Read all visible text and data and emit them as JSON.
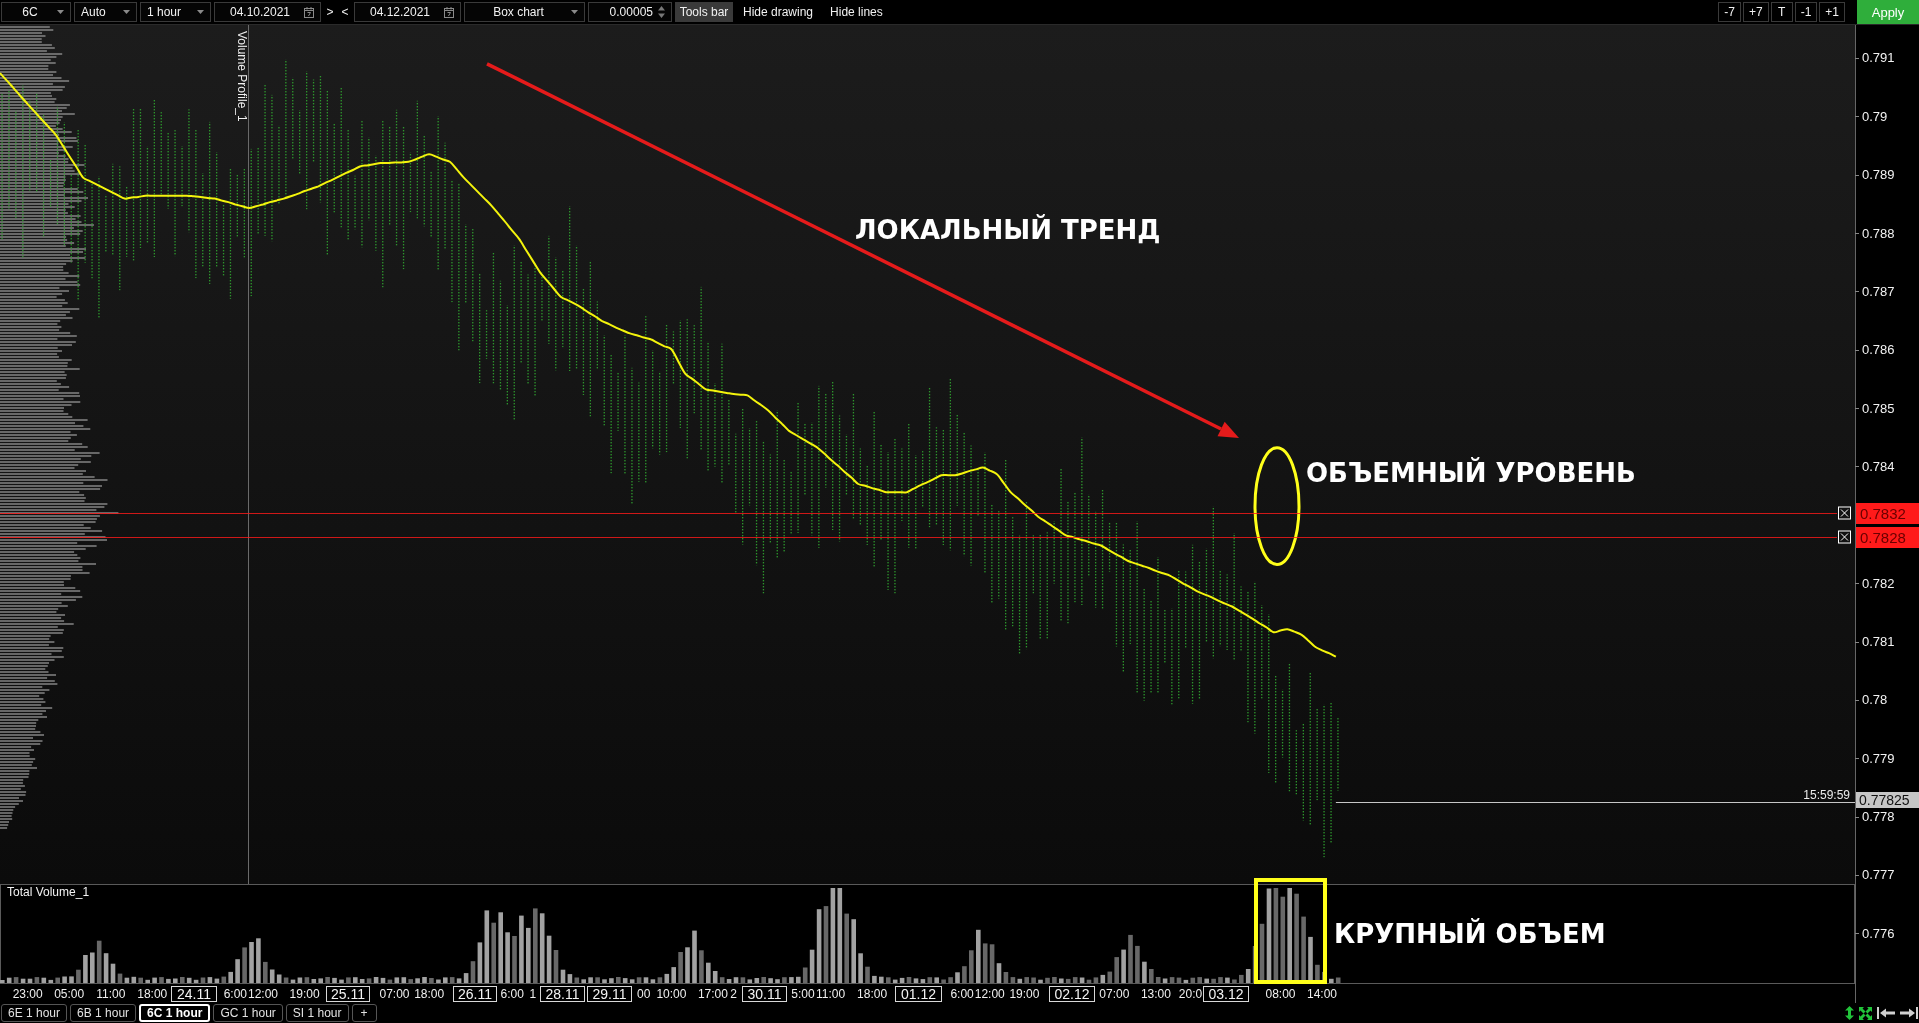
{
  "toolbar": {
    "left": [
      {
        "kind": "dropdown",
        "value": "6C"
      },
      {
        "kind": "dropdown",
        "value": "Auto"
      },
      {
        "kind": "dropdown",
        "value": "1 hour"
      },
      {
        "kind": "date",
        "value": "04.10.2021"
      },
      {
        "kind": "plain",
        "label": ">"
      },
      {
        "kind": "plain",
        "label": "<"
      },
      {
        "kind": "date",
        "value": "04.12.2021"
      },
      {
        "kind": "dropdown",
        "value": "Box chart"
      },
      {
        "kind": "spinner",
        "value": "0.00005"
      },
      {
        "kind": "toggle",
        "label": "Tools bar",
        "on": true
      },
      {
        "kind": "toggle",
        "label": "Hide drawing",
        "on": false
      },
      {
        "kind": "toggle",
        "label": "Hide lines",
        "on": false
      }
    ],
    "right": [
      {
        "kind": "step",
        "label": "-7"
      },
      {
        "kind": "step",
        "label": "+7"
      },
      {
        "kind": "step",
        "label": "T"
      },
      {
        "kind": "step",
        "label": "-1"
      },
      {
        "kind": "step",
        "label": "+1"
      },
      {
        "kind": "apply",
        "label": "Apply"
      }
    ]
  },
  "price_chart": {
    "indicator_label": "Volume Profile_1",
    "last_price_time": "15:59:59",
    "date_marks": [
      "24.11",
      "25.11",
      "26.11",
      "28.11",
      "29.11",
      "30.11",
      "01.12",
      "02.12",
      "03.12"
    ],
    "chart_data": {
      "type": "line",
      "categories": [
        null,
        null,
        null,
        null,
        "23:00",
        null,
        null,
        null,
        null,
        null,
        "05:00",
        null,
        null,
        null,
        null,
        null,
        "11:00",
        null,
        null,
        null,
        null,
        null,
        "18:00",
        null,
        null,
        null,
        null,
        null,
        null,
        null,
        null,
        null,
        null,
        null,
        "6:00",
        null,
        null,
        null,
        "12:00",
        null,
        null,
        null,
        null,
        null,
        "19:00",
        null,
        null,
        null,
        null,
        null,
        null,
        null,
        null,
        null,
        null,
        null,
        null,
        "07:00",
        null,
        null,
        null,
        null,
        "18:00",
        null,
        null,
        null,
        null,
        null,
        null,
        null,
        null,
        null,
        null,
        null,
        "6:00",
        null,
        null,
        "1",
        null,
        null,
        null,
        null,
        null,
        null,
        null,
        null,
        null,
        null,
        null,
        null,
        null,
        null,
        null,
        "00",
        null,
        null,
        null,
        "10:00",
        null,
        null,
        null,
        null,
        null,
        "17:00",
        null,
        null,
        "2",
        null,
        null,
        null,
        null,
        null,
        null,
        null,
        null,
        null,
        "5:00",
        null,
        null,
        null,
        "11:00",
        null,
        null,
        null,
        null,
        null,
        "18:00",
        null,
        null,
        null,
        null,
        null,
        null,
        null,
        null,
        null,
        null,
        null,
        null,
        "6:00",
        null,
        null,
        null,
        "12:00",
        null,
        null,
        null,
        null,
        "19:00",
        null,
        null,
        null,
        null,
        null,
        null,
        null,
        null,
        null,
        null,
        null,
        null,
        "07:00",
        null,
        null,
        null,
        null,
        null,
        "13:00",
        null,
        null,
        null,
        null,
        "20:0",
        null,
        null,
        null,
        null,
        null,
        null,
        null,
        null,
        null,
        null,
        null,
        null,
        "08:00",
        null,
        null,
        null,
        null,
        null,
        "14:00",
        null,
        null,
        null,
        null,
        null,
        null,
        null,
        null,
        null,
        null,
        null,
        null,
        null,
        null,
        null,
        null,
        null,
        null,
        null,
        null,
        null,
        null,
        null,
        null,
        null,
        null,
        null,
        null,
        null,
        null,
        null,
        null,
        null,
        null,
        null,
        null,
        null,
        null,
        null,
        null,
        null,
        null,
        null,
        null,
        null,
        null,
        null,
        null,
        null,
        null,
        null,
        null,
        null,
        null,
        null,
        null,
        null,
        null,
        null,
        null,
        null,
        null,
        null,
        null,
        null,
        null,
        null,
        null,
        null,
        null,
        null,
        null,
        null,
        null,
        null,
        null,
        null
      ],
      "values": [
        0.79074,
        0.79061,
        0.79048,
        0.79034,
        0.79021,
        0.79008,
        0.78995,
        0.78982,
        0.78969,
        0.78951,
        0.78932,
        0.78914,
        0.78895,
        0.78889,
        0.78883,
        0.78877,
        0.78871,
        0.78865,
        0.78859,
        0.78861,
        0.78862,
        0.78864,
        0.78864,
        0.78864,
        0.78864,
        0.78864,
        0.78864,
        0.78864,
        0.78863,
        0.78862,
        0.7886,
        0.78859,
        0.78856,
        0.78853,
        0.78849,
        0.78846,
        0.78843,
        0.78846,
        0.78849,
        0.78853,
        0.78856,
        0.78859,
        0.78863,
        0.78867,
        0.78872,
        0.78876,
        0.7888,
        0.78886,
        0.78891,
        0.78897,
        0.78903,
        0.78908,
        0.78914,
        0.78916,
        0.78918,
        0.7892,
        0.7892,
        0.78921,
        0.78921,
        0.78922,
        0.78926,
        0.78931,
        0.78935,
        0.78931,
        0.78926,
        0.78922,
        0.78909,
        0.78895,
        0.78883,
        0.78871,
        0.78859,
        0.78847,
        0.78833,
        0.78819,
        0.78804,
        0.7879,
        0.78771,
        0.78752,
        0.78733,
        0.78719,
        0.78705,
        0.78691,
        0.78685,
        0.78679,
        0.78672,
        0.78664,
        0.78657,
        0.78649,
        0.78644,
        0.78638,
        0.78633,
        0.78628,
        0.78625,
        0.78621,
        0.78618,
        0.78612,
        0.78606,
        0.78601,
        0.7858,
        0.78559,
        0.7855,
        0.78541,
        0.78532,
        0.7853,
        0.78528,
        0.78526,
        0.78524,
        0.78523,
        0.78522,
        0.78513,
        0.78505,
        0.78496,
        0.78484,
        0.78473,
        0.78461,
        0.78454,
        0.78447,
        0.7844,
        0.78433,
        0.78423,
        0.78412,
        0.78402,
        0.78391,
        0.78381,
        0.7837,
        0.78367,
        0.78363,
        0.7836,
        0.78356,
        0.78356,
        0.78356,
        0.78356,
        0.78362,
        0.78368,
        0.78373,
        0.78379,
        0.78385,
        0.78385,
        0.78385,
        0.78388,
        0.78392,
        0.78395,
        0.78398,
        0.78393,
        0.78387,
        0.78372,
        0.78356,
        0.78346,
        0.78335,
        0.78325,
        0.78314,
        0.78306,
        0.78298,
        0.7829,
        0.78282,
        0.78279,
        0.78275,
        0.78272,
        0.78268,
        0.78265,
        0.78258,
        0.78251,
        0.78245,
        0.78238,
        0.78234,
        0.7823,
        0.78226,
        0.78221,
        0.78217,
        0.78213,
        0.78206,
        0.78199,
        0.78193,
        0.78186,
        0.78181,
        0.78176,
        0.7817,
        0.78165,
        0.7816,
        0.78153,
        0.78146,
        0.78139,
        0.78131,
        0.78124,
        0.78116,
        0.78119,
        0.78121,
        0.78117,
        0.78112,
        0.78102,
        0.78091,
        0.78085,
        0.7808,
        0.78074,
        null,
        null,
        null,
        null,
        null,
        null,
        null,
        null,
        null,
        null,
        null,
        null,
        null,
        null,
        null,
        null,
        null,
        null,
        null,
        null,
        null,
        null,
        null,
        null,
        null,
        null,
        null,
        null,
        null,
        null,
        null,
        null,
        null,
        null,
        null,
        null,
        null,
        null,
        null,
        null,
        null,
        null,
        null,
        null,
        null,
        null,
        null,
        null,
        null,
        null,
        null,
        null,
        null,
        null,
        null,
        null,
        null,
        null,
        null,
        null,
        null,
        null,
        null,
        null,
        null,
        null,
        null,
        null,
        null,
        null,
        null,
        null,
        null,
        null,
        null
      ],
      "ylim": [
        0.775132,
        0.791565
      ],
      "yticks": [
        0.791,
        0.79,
        0.789,
        0.788,
        0.787,
        0.786,
        0.785,
        0.784,
        0.782,
        0.781,
        0.78,
        0.779,
        0.778,
        0.777,
        0.776
      ],
      "annotations": [
        "ЛОКАЛЬНЫЙ ТРЕНД",
        "ОБЪЕМНЫЙ УРОВЕНЬ"
      ],
      "ref_lines": [
        {
          "axis": "y",
          "value": 0.7832,
          "label": "0.7832",
          "color": "#ff1a1a"
        },
        {
          "axis": "y",
          "value": 0.7828,
          "label": "0.7828",
          "color": "#ff1a1a"
        },
        {
          "axis": "y",
          "value": 0.77825,
          "label": "0.77825",
          "color": "#c6c6c6"
        }
      ]
    }
  },
  "volume_pane": {
    "title": "Total Volume_1",
    "annotation": "КРУПНЫЙ ОБЪЕМ"
  },
  "tab_bar": {
    "tabs": [
      {
        "label": "6E 1 hour",
        "selected": false
      },
      {
        "label": "6B 1 hour",
        "selected": false
      },
      {
        "label": "6C 1 hour",
        "selected": true
      },
      {
        "label": "GC 1 hour",
        "selected": false
      },
      {
        "label": "SI 1 hour",
        "selected": false
      }
    ],
    "add_button": "+"
  }
}
